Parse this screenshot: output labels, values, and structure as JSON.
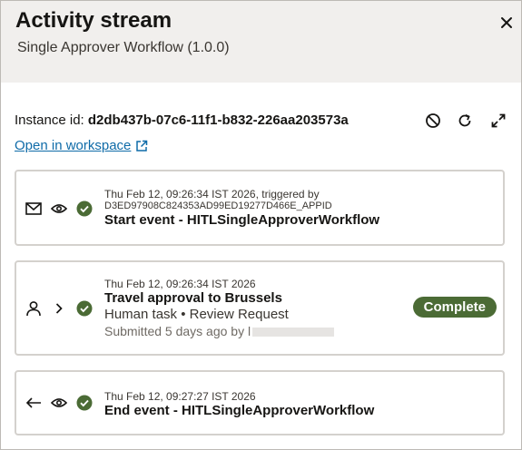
{
  "header": {
    "title": "Activity stream",
    "subtitle": "Single Approver Workflow (1.0.0)"
  },
  "instance": {
    "label": "Instance id:",
    "id": "d2db437b-07c6-11f1-b832-226aa203573a",
    "open_link": "Open in workspace"
  },
  "events": [
    {
      "timestamp": "Thu Feb 12, 09:26:34 IST 2026, triggered by",
      "trigger_id": "D3ED97908C824353AD99ED19277D466E_APPID",
      "title": "Start event - HITLSingleApproverWorkflow"
    },
    {
      "timestamp": "Thu Feb 12, 09:26:34 IST 2026",
      "title": "Travel approval to Brussels",
      "subtitle": "Human task • Review Request",
      "submitted": "Submitted 5 days ago by l",
      "status": "Complete"
    },
    {
      "timestamp": "Thu Feb 12, 09:27:27 IST 2026",
      "title": "End event - HITLSingleApproverWorkflow"
    }
  ],
  "colors": {
    "success": "#4b6b35",
    "link": "#0f6ba8",
    "header_bg": "#f1efed"
  }
}
